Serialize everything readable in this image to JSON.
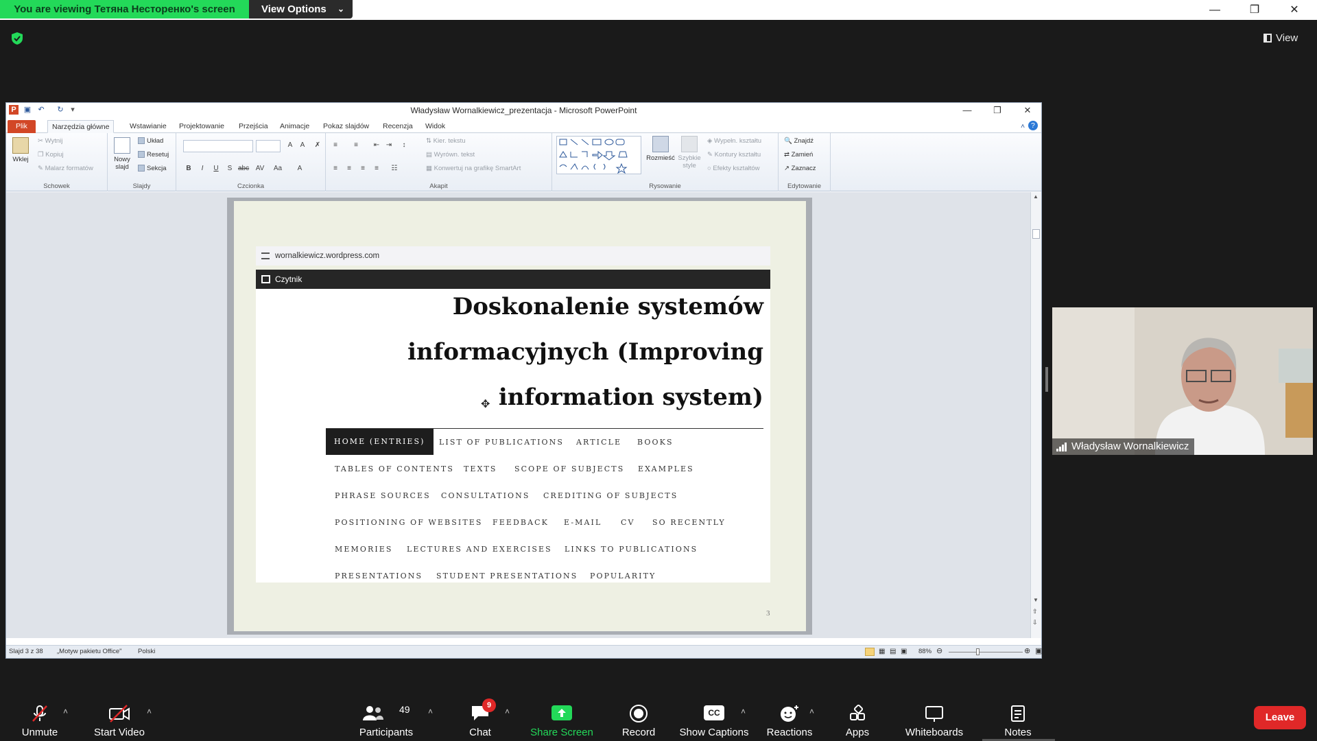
{
  "zoom_top": {
    "viewing_text": "You are viewing Тетяна Несторенко's screen",
    "view_options_label": "View Options",
    "view_label": "View"
  },
  "ppt": {
    "window_title": "Władysław Wornalkiewicz_prezentacja - Microsoft PowerPoint",
    "tabs": [
      "Plik",
      "Narzędzia główne",
      "Wstawianie",
      "Projektowanie",
      "Przejścia",
      "Animacje",
      "Pokaz slajdów",
      "Recenzja",
      "Widok"
    ],
    "ribbon": {
      "schowek": {
        "label": "Schowek",
        "paste": "Wklej",
        "cut": "Wytnij",
        "copy": "Kopiuj",
        "painter": "Malarz formatów"
      },
      "slajdy": {
        "label": "Slajdy",
        "new_slide": "Nowy slajd",
        "layout": "Układ",
        "reset": "Resetuj",
        "section": "Sekcja"
      },
      "czcionka": {
        "label": "Czcionka"
      },
      "akapit": {
        "label": "Akapit",
        "text_direction": "Kier. tekstu",
        "align_text": "Wyrówn. tekst",
        "smartart": "Konwertuj na grafikę SmartArt"
      },
      "rysowanie": {
        "label": "Rysowanie",
        "arrange": "Rozmieść",
        "quick_styles": "Szybkie style",
        "fill": "Wypełn. kształtu",
        "outline": "Kontury kształtu",
        "effects": "Efekty kształtów"
      },
      "edytowanie": {
        "label": "Edytowanie",
        "find": "Znajdź",
        "replace": "Zamień",
        "select": "Zaznacz"
      }
    },
    "status": {
      "slide": "Slajd 3 z 38",
      "theme": "„Motyw pakietu Office\"",
      "language": "Polski",
      "zoom": "88%"
    }
  },
  "slide": {
    "url": "wornalkiewicz.wordpress.com",
    "reader_label": "Czytnik",
    "headline_lines": [
      "Doskonalenie systemów",
      "informacyjnych (Improving",
      "information system)"
    ],
    "nav": {
      "home": "HOME (ENTRIES)",
      "list_of_publications": "LIST OF PUBLICATIONS",
      "article": "ARTICLE",
      "books": "BOOKS",
      "tables_of_contents": "TABLES OF CONTENTS",
      "texts": "TEXTS",
      "scope_of_subjects": "SCOPE OF SUBJECTS",
      "examples": "EXAMPLES",
      "phrase_sources": "PHRASE SOURCES",
      "consultations": "CONSULTATIONS",
      "crediting_of_subjects": "CREDITING OF SUBJECTS",
      "positioning_of_websites": "POSITIONING OF WEBSITES",
      "feedback": "FEEDBACK",
      "email": "E-MAIL",
      "cv": "CV",
      "so_recently": "SO RECENTLY",
      "memories": "MEMORIES",
      "lectures_and_exercises": "LECTURES AND EXERCISES",
      "links_to_publications": "LINKS TO PUBLICATIONS",
      "presentations": "PRESENTATIONS",
      "student_presentations": "STUDENT PRESENTATIONS",
      "popularity": "POPULARITY"
    },
    "slide_number": "3"
  },
  "video": {
    "name": "Władysław Wornalkiewicz"
  },
  "toolbar": {
    "unmute": "Unmute",
    "start_video": "Start Video",
    "participants": "Participants",
    "participants_count": "49",
    "chat": "Chat",
    "chat_badge": "9",
    "share_screen": "Share Screen",
    "record": "Record",
    "show_captions": "Show Captions",
    "captions_icon": "CC",
    "reactions": "Reactions",
    "apps": "Apps",
    "whiteboards": "Whiteboards",
    "notes": "Notes",
    "leave": "Leave"
  },
  "colors": {
    "zoom_green": "#23d959",
    "leave_red": "#e02828",
    "ppt_file_tab": "#d24726"
  }
}
